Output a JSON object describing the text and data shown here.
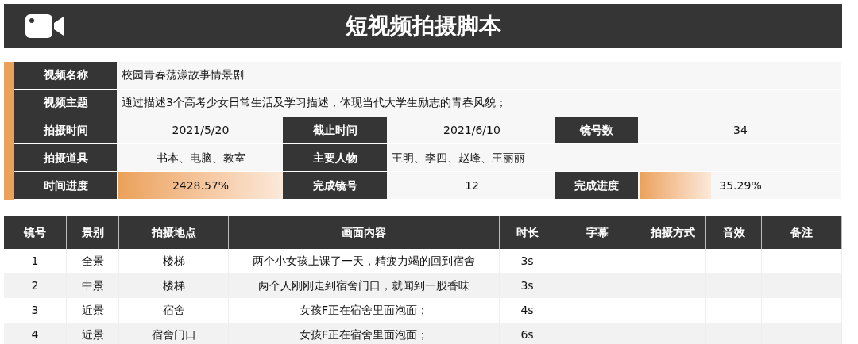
{
  "title": "短视频拍摄脚本",
  "info": {
    "rows": [
      {
        "cells": [
          {
            "kind": "label",
            "text": "视频名称"
          },
          {
            "kind": "value",
            "text": "校园青春荡漾故事情景剧"
          }
        ]
      },
      {
        "cells": [
          {
            "kind": "label",
            "text": "视频主题"
          },
          {
            "kind": "value",
            "text": "通过描述3个高考少女日常生活及学习描述，体现当代大学生励志的青春风貌；"
          }
        ]
      },
      {
        "cells": [
          {
            "kind": "label",
            "text": "拍摄时间"
          },
          {
            "kind": "value",
            "text": "2021/5/20"
          },
          {
            "kind": "label",
            "text": "截止时间"
          },
          {
            "kind": "value",
            "text": "2021/6/10"
          },
          {
            "kind": "label",
            "text": "镜号数"
          },
          {
            "kind": "value",
            "text": "34"
          }
        ]
      },
      {
        "cells": [
          {
            "kind": "label",
            "text": "拍摄道具"
          },
          {
            "kind": "value",
            "text": "书本、电脑、教室"
          },
          {
            "kind": "label",
            "text": "主要人物"
          },
          {
            "kind": "value",
            "text": "王明、李四、赵峰、王丽丽"
          }
        ]
      },
      {
        "cells": [
          {
            "kind": "label",
            "text": "时间进度"
          },
          {
            "kind": "progress",
            "text": "2428.57%",
            "level": 1
          },
          {
            "kind": "label",
            "text": "完成镜号"
          },
          {
            "kind": "value",
            "text": "12"
          },
          {
            "kind": "label",
            "text": "完成进度"
          },
          {
            "kind": "progress",
            "text": "35.29%",
            "level": 0.3529
          }
        ]
      }
    ]
  },
  "table": {
    "columns": [
      "镜号",
      "景别",
      "拍摄地点",
      "画面内容",
      "时长",
      "字幕",
      "拍摄方式",
      "音效",
      "备注"
    ],
    "rows": [
      [
        "1",
        "全景",
        "楼梯",
        "两个小女孩上课了一天，精疲力竭的回到宿舍",
        "3s",
        "",
        "",
        "",
        ""
      ],
      [
        "2",
        "中景",
        "楼梯",
        "两个人刚刚走到宿舍门口，就闻到一股香味",
        "3s",
        "",
        "",
        "",
        ""
      ],
      [
        "3",
        "近景",
        "宿舍",
        "女孩F正在宿舍里面泡面；",
        "4s",
        "",
        "",
        "",
        ""
      ],
      [
        "4",
        "近景",
        "宿舍门口",
        "女孩F正在宿舍里面泡面；",
        "6s",
        "",
        "",
        "",
        ""
      ]
    ]
  }
}
